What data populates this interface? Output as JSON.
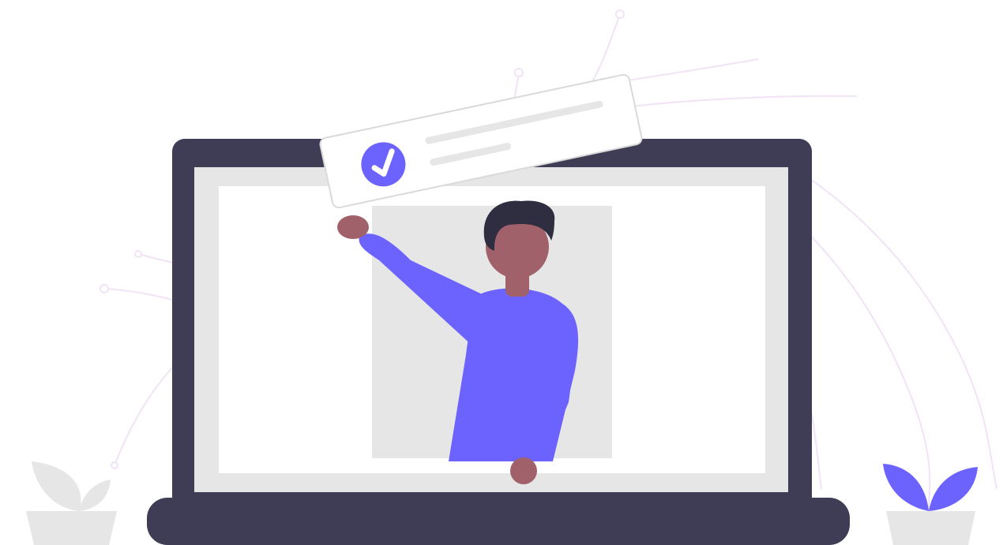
{
  "illustration": {
    "subject": "person-presenting-checked-card-through-laptop",
    "icons": [
      "check-circle-icon",
      "laptop-icon",
      "plant-icon",
      "circuit-lines"
    ]
  },
  "colors": {
    "background": "#ffffff",
    "circuit_lines": "#f1e3f5",
    "laptop_frame": "#3f3d56",
    "laptop_screen": "#e6e6e6",
    "screen_inner": "#ffffff",
    "backdrop_panel": "#e6e6e6",
    "card": "#ffffff",
    "card_border": "#d9d9d9",
    "card_lines": "#e6e6e6",
    "accent": "#6c63ff",
    "skin": "#a0616a",
    "hair": "#2f2e41",
    "plant_grey": "#e6e6e6"
  }
}
